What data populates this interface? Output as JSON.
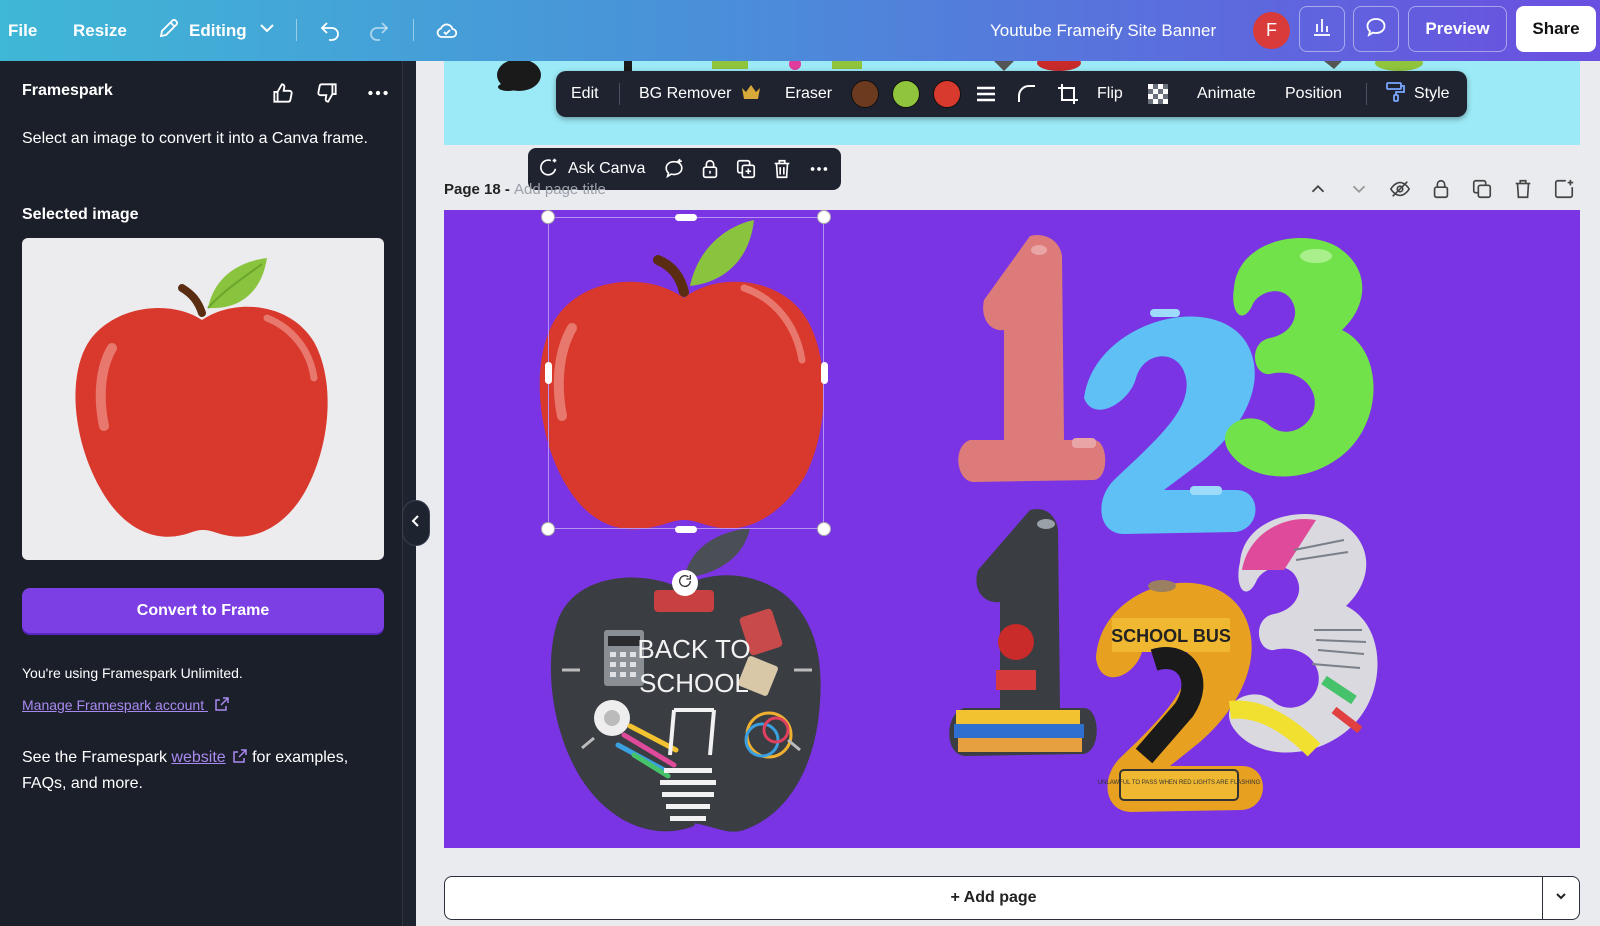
{
  "topbar": {
    "file": "File",
    "resize": "Resize",
    "editing": "Editing",
    "doc_title": "Youtube Frameify Site Banner",
    "avatar_initial": "F",
    "preview": "Preview",
    "share": "Share",
    "gradient_colors": [
      "#3fb7d6",
      "#4a8fd9",
      "#6a4fe0"
    ]
  },
  "panel": {
    "title": "Framespark",
    "description": "Select an image to convert it into a Canva frame.",
    "selected_label": "Selected image",
    "convert_button": "Convert to Frame",
    "unlimited_text": "You're using Framespark Unlimited.",
    "manage_link": "Manage Framespark account",
    "see_prefix": "See the Framespark ",
    "see_link": "website",
    "see_suffix": " for examples, FAQs, and more."
  },
  "image_toolbar": {
    "edit": "Edit",
    "bg_remover": "BG Remover",
    "eraser": "Eraser",
    "swatches": [
      "#6b3a1f",
      "#8fc43c",
      "#d93a2e"
    ],
    "flip": "Flip",
    "animate": "Animate",
    "position": "Position",
    "style": "Style"
  },
  "ask_toolbar": {
    "ask_canva": "Ask Canva"
  },
  "page": {
    "number_label": "Page 18 - ",
    "title_placeholder": "Add page title",
    "background_color": "#7a34e3"
  },
  "canvas": {
    "back_to_school_line1": "BACK TO",
    "back_to_school_line2": "SCHOOL",
    "school_bus": "SCHOOL BUS",
    "bus_small_text": "UNLAWFUL TO PASS WHEN RED LIGHTS ARE FLASHING",
    "numbers_top": [
      "1",
      "2",
      "3"
    ],
    "number_colors": [
      "#dd7b7b",
      "#5ec0f5",
      "#72e24a"
    ]
  },
  "add_page": "+ Add page"
}
